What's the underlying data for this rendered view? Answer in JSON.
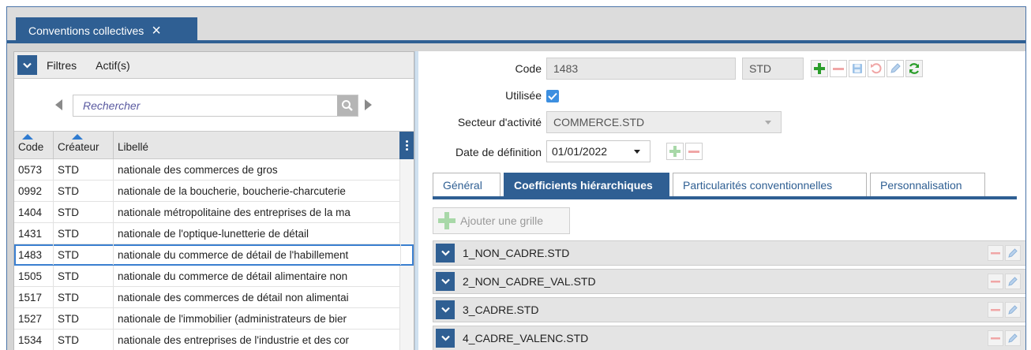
{
  "window": {
    "tab_title": "Conventions collectives",
    "tab_close": "×"
  },
  "filters": {
    "label": "Filtres",
    "state": "Actif(s)"
  },
  "search": {
    "placeholder": "Rechercher"
  },
  "table": {
    "columns": [
      "Code",
      "Créateur",
      "Libellé"
    ],
    "sorted_columns": [
      "Code",
      "Créateur"
    ],
    "rows": [
      {
        "code": "0573",
        "creator": "STD",
        "label": "nationale des commerces de gros"
      },
      {
        "code": "0992",
        "creator": "STD",
        "label": "nationale de la boucherie, boucherie-charcuterie"
      },
      {
        "code": "1404",
        "creator": "STD",
        "label": "nationale métropolitaine des entreprises de la ma"
      },
      {
        "code": "1431",
        "creator": "STD",
        "label": "nationale de l'optique-lunetterie de détail"
      },
      {
        "code": "1483",
        "creator": "STD",
        "label": "nationale du commerce de détail de l'habillement"
      },
      {
        "code": "1505",
        "creator": "STD",
        "label": "nationale du commerce de détail alimentaire non"
      },
      {
        "code": "1517",
        "creator": "STD",
        "label": "nationale des commerces de détail non alimentai"
      },
      {
        "code": "1527",
        "creator": "STD",
        "label": "nationale de l'immobilier (administrateurs de bier"
      },
      {
        "code": "1534",
        "creator": "STD",
        "label": "nationale des entreprises de l'industrie et des cor"
      }
    ],
    "selected_code": "1483"
  },
  "detail": {
    "code_label": "Code",
    "code_value": "1483",
    "creator_value": "STD",
    "used_label": "Utilisée",
    "used_checked": true,
    "sector_label": "Secteur d'activité",
    "sector_value": "COMMERCE.STD",
    "date_label": "Date de définition",
    "date_value": "01/01/2022"
  },
  "tabs": [
    {
      "label": "Général",
      "active": false
    },
    {
      "label": "Coefficients hiérarchiques",
      "active": true
    },
    {
      "label": "Particularités conventionnelles",
      "active": false
    },
    {
      "label": "Personnalisation",
      "active": false
    }
  ],
  "grids": {
    "add_label": "Ajouter une grille",
    "items": [
      "1_NON_CADRE.STD",
      "2_NON_CADRE_VAL.STD",
      "3_CADRE.STD",
      "4_CADRE_VALENC.STD"
    ]
  },
  "colors": {
    "accent": "#2f5f93",
    "checkbox": "#3d8fe0",
    "add_green": "#2a9d2a",
    "remove_red": "#e05a5a",
    "selection": "#3a7fd0"
  }
}
